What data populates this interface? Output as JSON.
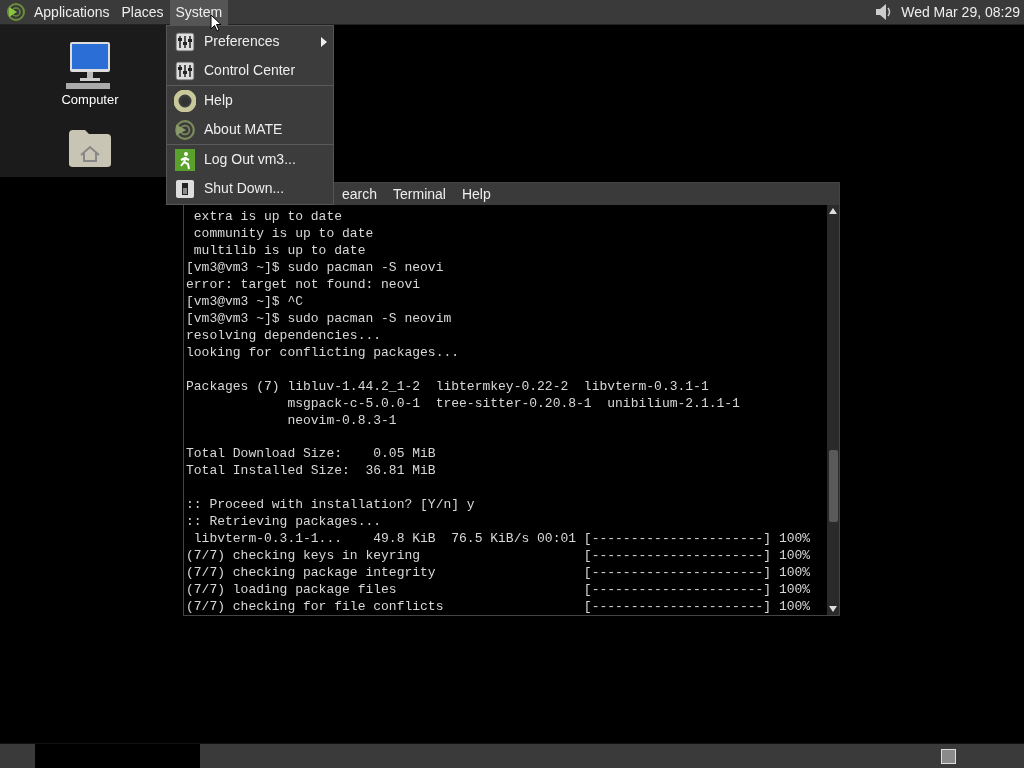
{
  "top_panel": {
    "menus": [
      {
        "label": "Applications",
        "selected": false
      },
      {
        "label": "Places",
        "selected": false
      },
      {
        "label": "System",
        "selected": true
      }
    ],
    "clock": "Wed Mar 29, 08:29"
  },
  "desktop_icons": [
    {
      "kind": "computer",
      "label": "Computer"
    },
    {
      "kind": "home"
    }
  ],
  "system_menu": {
    "groups": [
      [
        {
          "kind": "prefs",
          "label": "Preferences",
          "submenu": true
        },
        {
          "kind": "prefs",
          "label": "Control Center",
          "submenu": false
        }
      ],
      [
        {
          "kind": "help",
          "label": "Help",
          "submenu": false
        },
        {
          "kind": "mate",
          "label": "About MATE",
          "submenu": false
        }
      ],
      [
        {
          "kind": "logout",
          "label": "Log Out vm3...",
          "submenu": false
        },
        {
          "kind": "shutdown",
          "label": "Shut Down...",
          "submenu": false
        }
      ]
    ]
  },
  "terminal": {
    "menus": [
      "earch",
      "Terminal",
      "Help"
    ],
    "blocks": [
      [
        " extra is up to date",
        " community is up to date",
        " multilib is up to date",
        "[vm3@vm3 ~]$ sudo pacman -S neovi",
        "error: target not found: neovi",
        "[vm3@vm3 ~]$ ^C",
        "[vm3@vm3 ~]$ sudo pacman -S neovim",
        "resolving dependencies...",
        "looking for conflicting packages..."
      ],
      [
        "Packages (7) libluv-1.44.2_1-2  libtermkey-0.22-2  libvterm-0.3.1-1",
        "             msgpack-c-5.0.0-1  tree-sitter-0.20.8-1  unibilium-2.1.1-1",
        "             neovim-0.8.3-1"
      ],
      [
        "Total Download Size:    0.05 MiB",
        "Total Installed Size:  36.81 MiB"
      ],
      [
        ":: Proceed with installation? [Y/n] y",
        ":: Retrieving packages...",
        " libvterm-0.3.1-1...    49.8 KiB  76.5 KiB/s 00:01 [----------------------] 100%",
        "(7/7) checking keys in keyring                     [----------------------] 100%",
        "(7/7) checking package integrity                   [----------------------] 100%",
        "(7/7) loading package files                        [----------------------] 100%",
        "(7/7) checking for file conflicts                  [----------------------] 100%"
      ]
    ]
  }
}
